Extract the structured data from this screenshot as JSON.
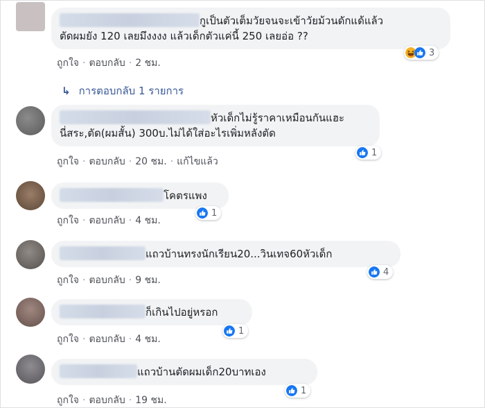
{
  "actions": {
    "like": "ถูกใจ",
    "reply": "ตอบกลับ",
    "separator": "·"
  },
  "comments": [
    {
      "line1": "กูเป็นตัวเต็มวัยจนจะเข้าวัยม้วนดักแด้แล้ว",
      "line2": "ตัดผมยัง 120 เลยมึงงงง แล้วเด็กตัวแค่นี้ 250 เลยอ่อ ??",
      "time": "2 ชม.",
      "reactions": [
        "haha",
        "like"
      ],
      "count": "3"
    },
    {
      "line1": "หัวเด็กไม่รู้ราคาเหมือนกันแฮะ",
      "line2": "นี่สระ,ตัด(ผมสั้น) 300บ.ไม่ได้ใส่อะไรเพิ่มหลังตัด",
      "time": "20 ชม.",
      "edited": "แก้ไขแล้ว",
      "reactions": [
        "like"
      ],
      "count": "1"
    },
    {
      "text": "โคตรแพง",
      "time": "4 ชม.",
      "reactions": [
        "like"
      ],
      "count": "1"
    },
    {
      "text": "แถวบ้านทรงนักเรียน20...วินเทจ60หัวเด็ก",
      "time": "9 ชม.",
      "reactions": [
        "like"
      ],
      "count": "4"
    },
    {
      "text": "ก็เกินไปอยู่หรอก",
      "time": "4 ชม.",
      "reactions": [
        "like"
      ],
      "count": "1"
    },
    {
      "text": "แถวบ้านตัดผมเด็ก20บาทเอง",
      "time": "19 ชม.",
      "reactions": [
        "like"
      ],
      "count": "1"
    }
  ],
  "replies_link": {
    "arrow": "↳",
    "label": "การตอบกลับ 1 รายการ"
  },
  "colors": {
    "bubble": "#f2f3f5",
    "like_blue": "#1877f2",
    "haha_yellow": "#f7b125",
    "link": "#385898"
  }
}
